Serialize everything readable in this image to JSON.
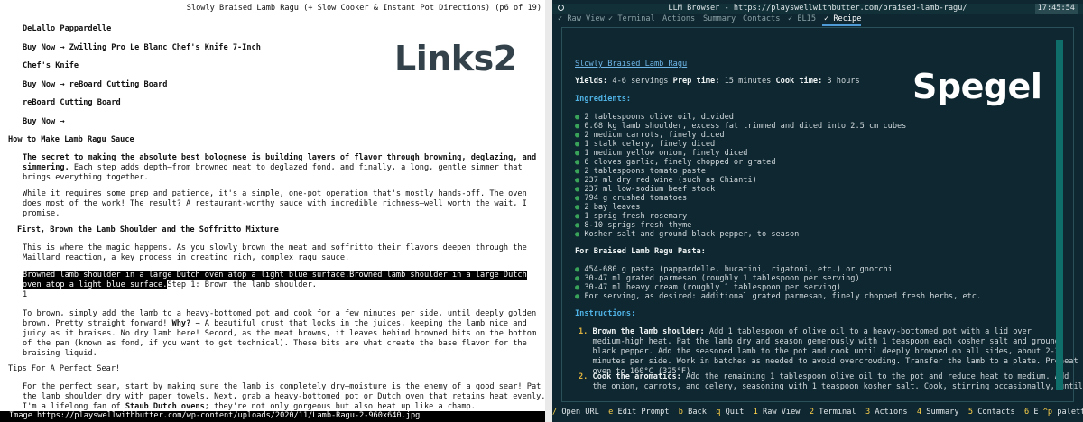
{
  "left": {
    "title": "Slowly Braised Lamb Ragu (+ Slow Cooker & Instant Pot Directions) (p6 of 19)",
    "items": [
      {
        "label": "DeLallo Pappardelle"
      },
      {
        "label": "Buy Now → Zwilling Pro Le Blanc Chef's Knife 7-Inch"
      },
      {
        "label": "Chef's Knife"
      },
      {
        "label": "Buy Now → reBoard Cutting Board"
      },
      {
        "label": "reBoard Cutting Board"
      },
      {
        "label": "Buy Now →"
      }
    ],
    "heading_how": "How to Make Lamb Ragu Sauce",
    "p1_bold_line1": "The secret to making the absolute best bolognese is building layers of flavor through browning, deglazing, and",
    "p1_bold_line2_start": "simmering.",
    "p1_rest_line2": " Each step adds depth—from browned meat to deglazed fond, and finally, a long, gentle simmer that",
    "p1_line3": "brings everything together.",
    "p2_line1": "While it requires some prep and patience, it's a simple, one-pot operation that's mostly hands-off. The oven",
    "p2_line2": "does most of the work! The result? A restaurant-worthy sauce with incredible richness—well worth the wait, I",
    "p2_line3": "promise.",
    "heading_first": "First, Brown the Lamb Shoulder and the Soffritto Mixture",
    "p3_line1": "This is where the magic happens. As you slowly brown the meat and soffritto their flavors deepen through the",
    "p3_line2": "Maillard reaction, a key process in creating rich, complex ragu sauce.",
    "sel_line1": "Browned lamb shoulder in a large Dutch oven atop a light blue surface.Browned lamb shoulder in a large Dutch",
    "sel_line2": "oven atop a light blue surface.",
    "step_text": "Step 1: Brown the lamb shoulder.",
    "step_num": "1",
    "p4_line1": "To brown, simply add the lamb to a heavy-bottomed pot and cook for a few minutes per side, until deeply golden",
    "p4_line2_start": "brown. Pretty straight forward! ",
    "p4_why": "Why?",
    "p4_line2_end": " → A beautiful crust that locks in the juices, keeping the lamb nice and",
    "p4_line3": "juicy as it braises. No dry lamb here! Second, as the meat browns, it leaves behind browned bits on the bottom",
    "p4_line4": "of the pan (known as fond, if you want to get technical). These bits are what create the base flavor for the",
    "p4_line5": "braising liquid.",
    "tips_heading": "Tips For A Perfect Sear!",
    "p5_line1": "For the perfect sear, start by making sure the lamb is completely dry—moisture is the enemy of a good sear! Pat",
    "p5_line2": "the lamb shoulder dry with paper towels. Next, grab a heavy-bottomed pot or Dutch oven that retains heat evenly.",
    "p5_line3_start": "I'm a lifelong fan of ",
    "p5_staub": "Staub Dutch ovens",
    "p5_line3_end": "; they're not only gorgeous but also heat up like a champ.",
    "footer": "Image https://playswellwithbutter.com/wp-content/uploads/2020/11/Lamb-Ragu-2-960x640.jpg"
  },
  "right": {
    "window_title": "LLM Browser - https://playswellwithbutter.com/braised-lamb-ragu/",
    "time": "17:45:54",
    "tabs": [
      {
        "label": "✓ Raw View"
      },
      {
        "label": "✓ Terminal"
      },
      {
        "label": "Actions"
      },
      {
        "label": "Summary"
      },
      {
        "label": "Contacts"
      },
      {
        "label": "✓ ELI5"
      },
      {
        "label": "✓ Recipe"
      }
    ],
    "recipe_link": "Slowly Braised Lamb Ragu",
    "yields_label": "Yields:",
    "yields_value": " 4-6 servings ",
    "prep_label": "Prep time:",
    "prep_value": " 15 minutes ",
    "cook_label": "Cook time:",
    "cook_value": " 3 hours",
    "ingredients_heading": "Ingredients:",
    "ingredients": [
      "2 tablespoons olive oil, divided",
      "0.68 kg lamb shoulder, excess fat trimmed and diced into 2.5 cm cubes",
      "2 medium carrots, finely diced",
      "1 stalk celery, finely diced",
      "1 medium yellow onion, finely diced",
      "6 cloves garlic, finely chopped or grated",
      "2 tablespoons tomato paste",
      "237 ml dry red wine (such as Chianti)",
      "237 ml low-sodium beef stock",
      "794 g crushed tomatoes",
      "2 bay leaves",
      "1 sprig fresh rosemary",
      "8-10 sprigs fresh thyme",
      "Kosher salt and ground black pepper, to season"
    ],
    "pasta_heading": "For Braised Lamb Ragu Pasta:",
    "pasta": [
      "454-680 g pasta (pappardelle, bucatini, rigatoni, etc.) or gnocchi",
      "30-47 ml grated parmesan (roughly 1 tablespoon per serving)",
      "30-47 ml heavy cream (roughly 1 tablespoon per serving)",
      "For serving, as desired: additional grated parmesan, finely chopped fresh herbs, etc."
    ],
    "instructions_heading": "Instructions:",
    "instructions": [
      {
        "num": "1.",
        "title": "Brown the lamb shoulder:",
        "lines": [
          " Add 1 tablespoon of olive oil to a heavy-bottomed pot with a lid over",
          "medium-high heat. Pat the lamb dry and season generously with 1 teaspoon each kosher salt and ground",
          "black pepper. Add the seasoned lamb to the pot and cook until deeply browned on all sides, about 2-3",
          "minutes per side. Work in batches as needed to avoid overcrowding. Transfer the lamb to a plate. Preheat",
          "oven to 160°C (325°F)."
        ]
      },
      {
        "num": "2.",
        "title": "Cook the aromatics:",
        "lines": [
          " Add the remaining 1 tablespoon olive oil to the pot and reduce heat to medium. Add",
          "the onion, carrots, and celery, seasoning with 1 teaspoon kosher salt. Cook, stirring occasionally, until"
        ]
      }
    ],
    "footer_keys": [
      {
        "key": "/",
        "label": "Open URL"
      },
      {
        "key": "e",
        "label": "Edit Prompt"
      },
      {
        "key": "b",
        "label": "Back"
      },
      {
        "key": "q",
        "label": "Quit"
      },
      {
        "key": "1",
        "label": "Raw View"
      },
      {
        "key": "2",
        "label": "Terminal"
      },
      {
        "key": "3",
        "label": "Actions"
      },
      {
        "key": "4",
        "label": "Summary"
      },
      {
        "key": "5",
        "label": "Contacts"
      },
      {
        "key": "6",
        "label": "E"
      },
      {
        "key": "^p",
        "label": "palette"
      }
    ]
  },
  "watermarks": {
    "left": "Links2",
    "right": "Spegel"
  },
  "colors": {
    "terminal_bg": "#0f2730",
    "heading_blue": "#4fb3e6",
    "bullet_green": "#3aa35a",
    "number_yellow": "#e0b23f",
    "scrollbar_teal": "#0f6e69"
  }
}
